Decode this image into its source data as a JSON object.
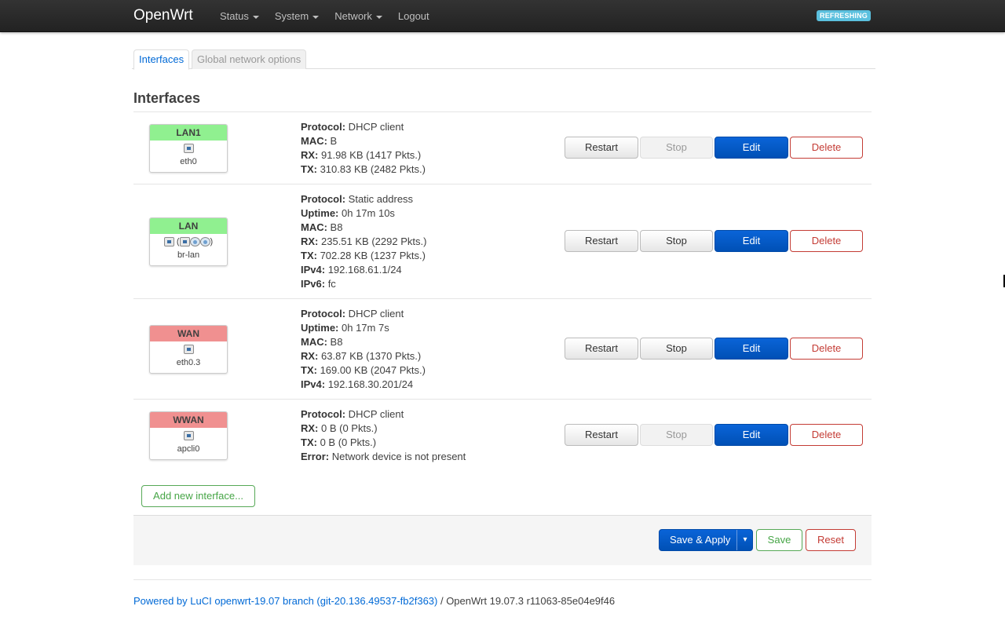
{
  "navbar": {
    "brand": "OpenWrt",
    "menu": [
      "Status",
      "System",
      "Network",
      "Logout"
    ],
    "refresh_badge": "REFRESHING"
  },
  "tabs": [
    "Interfaces",
    "Global network options"
  ],
  "section_title": "Interfaces",
  "interfaces": [
    {
      "name": "LAN1",
      "device": "eth0",
      "head_color": "#90f090",
      "details": [
        {
          "k": "Protocol:",
          "v": " DHCP client"
        },
        {
          "k": "MAC:",
          "v": " B"
        },
        {
          "k": "RX:",
          "v": " 91.98 KB (1417 Pkts.)"
        },
        {
          "k": "TX:",
          "v": " 310.83 KB (2482 Pkts.)"
        }
      ],
      "buttons": {
        "restart": "Restart",
        "stop": "Stop",
        "edit": "Edit",
        "delete": "Delete"
      },
      "stop_disabled": true
    },
    {
      "name": "LAN",
      "device": "br-lan",
      "head_color": "#90f090",
      "details": [
        {
          "k": "Protocol:",
          "v": " Static address"
        },
        {
          "k": "Uptime:",
          "v": " 0h 17m 10s"
        },
        {
          "k": "MAC:",
          "v": " B8"
        },
        {
          "k": "RX:",
          "v": " 235.51 KB (2292 Pkts.)"
        },
        {
          "k": "TX:",
          "v": " 702.28 KB (1237 Pkts.)"
        },
        {
          "k": "IPv4:",
          "v": " 192.168.61.1/24"
        },
        {
          "k": "IPv6:",
          "v": " fc"
        }
      ],
      "buttons": {
        "restart": "Restart",
        "stop": "Stop",
        "edit": "Edit",
        "delete": "Delete"
      },
      "stop_disabled": false
    },
    {
      "name": "WAN",
      "device": "eth0.3",
      "head_color": "#f09090",
      "details": [
        {
          "k": "Protocol:",
          "v": " DHCP client"
        },
        {
          "k": "Uptime:",
          "v": " 0h 17m 7s"
        },
        {
          "k": "MAC:",
          "v": " B8"
        },
        {
          "k": "RX:",
          "v": " 63.87 KB (1370 Pkts.)"
        },
        {
          "k": "TX:",
          "v": " 169.00 KB (2047 Pkts.)"
        },
        {
          "k": "IPv4:",
          "v": " 192.168.30.201/24"
        }
      ],
      "buttons": {
        "restart": "Restart",
        "stop": "Stop",
        "edit": "Edit",
        "delete": "Delete"
      },
      "stop_disabled": false
    },
    {
      "name": "WWAN",
      "device": "apcli0",
      "head_color": "#f09090",
      "details": [
        {
          "k": "Protocol:",
          "v": " DHCP client"
        },
        {
          "k": "RX:",
          "v": " 0 B (0 Pkts.)"
        },
        {
          "k": "TX:",
          "v": " 0 B (0 Pkts.)"
        },
        {
          "k": "Error:",
          "v": " Network device is not present"
        }
      ],
      "buttons": {
        "restart": "Restart",
        "stop": "Stop",
        "edit": "Edit",
        "delete": "Delete"
      },
      "stop_disabled": true
    }
  ],
  "add_interface_label": "Add new interface...",
  "actions": {
    "save_apply": "Save & Apply",
    "save_apply_arrow": "▾",
    "save": "Save",
    "reset": "Reset"
  },
  "footer": {
    "link_text": "Powered by LuCI openwrt-19.07 branch (git-20.136.49537-fb2f363)",
    "version_text": " / OpenWrt 19.07.3 r11063-85e04e9f46"
  }
}
